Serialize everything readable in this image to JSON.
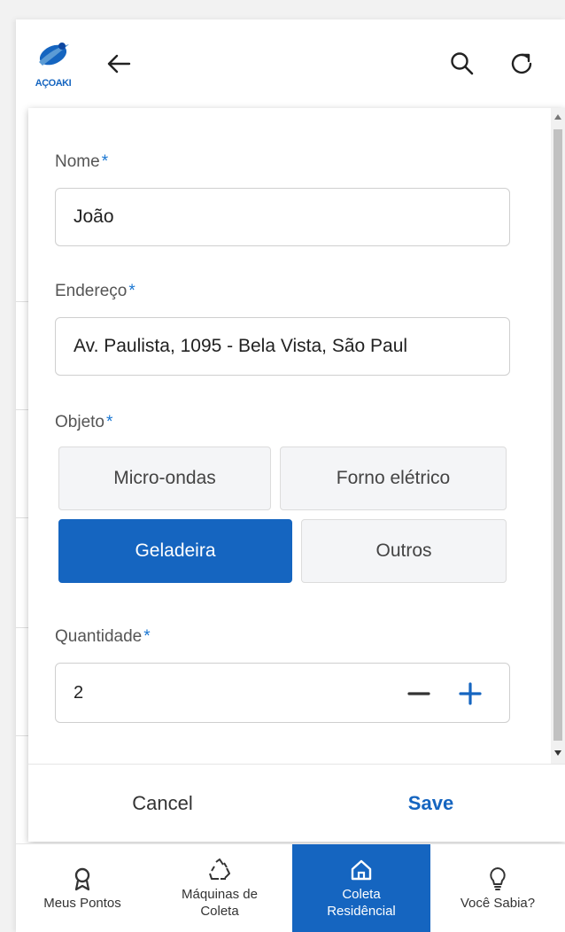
{
  "header": {
    "logo_text": "AÇOAKI",
    "back_icon": "arrow-left-icon",
    "search_icon": "search-icon",
    "refresh_icon": "refresh-icon"
  },
  "form": {
    "nome": {
      "label": "Nome",
      "required_mark": "*",
      "value": "João"
    },
    "endereco": {
      "label": "Endereço",
      "required_mark": "*",
      "value": "Av. Paulista, 1095 - Bela Vista, São Paul"
    },
    "objeto": {
      "label": "Objeto",
      "required_mark": "*",
      "options": [
        "Micro-ondas",
        "Forno elétrico",
        "Geladeira",
        "Outros"
      ],
      "selected": "Geladeira"
    },
    "quantidade": {
      "label": "Quantidade",
      "required_mark": "*",
      "value": "2"
    }
  },
  "footer": {
    "cancel_label": "Cancel",
    "save_label": "Save"
  },
  "bottom_nav": {
    "items": [
      {
        "label": "Meus Pontos",
        "icon": "award-icon",
        "active": false
      },
      {
        "label": "Máquinas de\nColeta",
        "icon": "recycle-icon",
        "active": false
      },
      {
        "label": "Coleta\nResidêncial",
        "icon": "home-icon",
        "active": true
      },
      {
        "label": "Você Sabia?",
        "icon": "lightbulb-icon",
        "active": false
      }
    ]
  },
  "colors": {
    "accent": "#1565c0",
    "required": "#1976d2"
  }
}
